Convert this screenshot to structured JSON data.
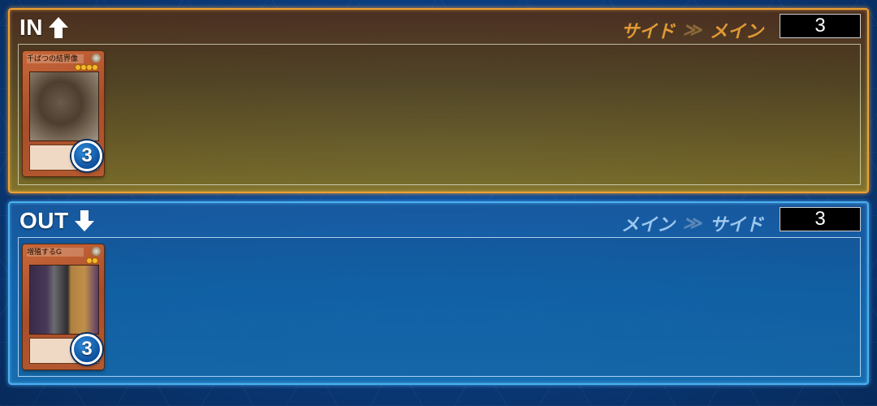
{
  "in_panel": {
    "title": "IN",
    "route_from": "サイド",
    "route_sep": "≫",
    "route_to": "メイン",
    "count": "3",
    "card": {
      "name": "千ばつの結界像",
      "stars": 4,
      "quantity": "3"
    }
  },
  "out_panel": {
    "title": "OUT",
    "route_from": "メイン",
    "route_sep": "≫",
    "route_to": "サイド",
    "count": "3",
    "card": {
      "name": "増殖するG",
      "stars": 2,
      "quantity": "3"
    }
  },
  "icons": {
    "in_arrow": "arrow-up-icon",
    "out_arrow": "arrow-down-icon"
  },
  "colors": {
    "in_accent": "#f0a030",
    "out_accent": "#4ab0f0",
    "badge": "#0d4f9c"
  }
}
